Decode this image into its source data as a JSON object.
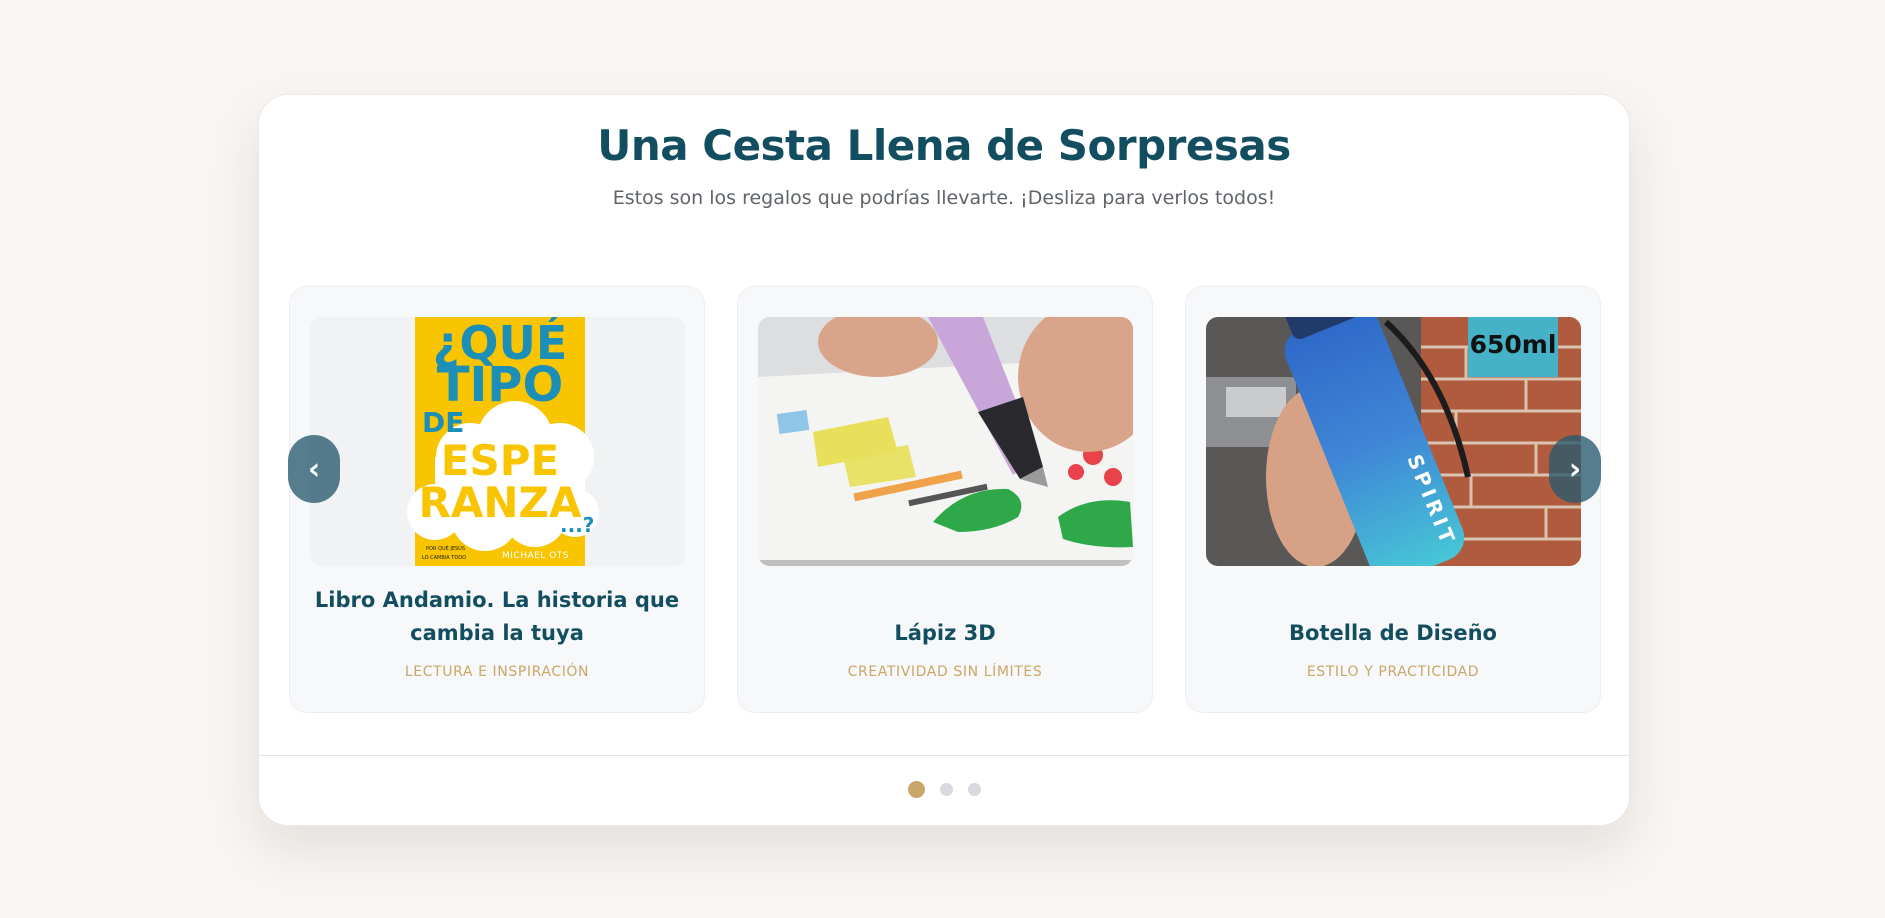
{
  "section": {
    "title": "Una Cesta Llena de Sorpresas",
    "subtitle": "Estos son los regalos que podrías llevarte. ¡Desliza para verlos todos!"
  },
  "carousel": {
    "prev_icon": "‹",
    "next_icon": "›",
    "slides": [
      {
        "name": "Libro Andamio. La historia que cambia la tuya",
        "tag": "LECTURA E INSPIRACIÓN",
        "image": {
          "kind": "book-cover",
          "lines": [
            "¿QUÉ",
            "TIPO",
            "DE",
            "ESPE",
            "RANZA",
            "...?"
          ],
          "blurb": [
            "POR QUÉ JESÚS",
            "LO CAMBIA TODO"
          ],
          "author": "MICHAEL OTS"
        }
      },
      {
        "name": "Lápiz 3D",
        "tag": "CREATIVIDAD SIN LÍMITES",
        "image": {
          "kind": "photo-3d-pen"
        }
      },
      {
        "name": "Botella de Diseño",
        "tag": "ESTILO Y PRACTICIDAD",
        "image": {
          "kind": "photo-bottle",
          "badge": "650ml",
          "bottle_text": "SPIRIT"
        }
      }
    ]
  },
  "pagination": {
    "count": 3,
    "active_index": 0
  },
  "colors": {
    "accent_gold": "#c8a768",
    "title_teal": "#124e60",
    "nav_button": "#285a6e",
    "dot_inactive": "#d7d9de",
    "book_yellow": "#f9c400",
    "book_blue": "#1b8fb7"
  }
}
